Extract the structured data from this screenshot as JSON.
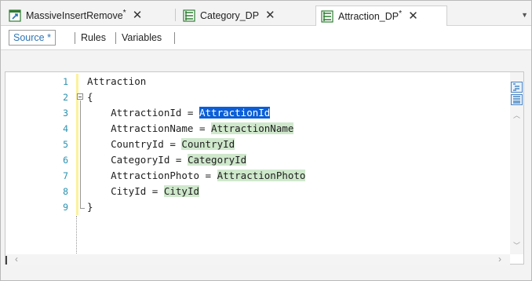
{
  "tabs": [
    {
      "label": "MassiveInsertRemove",
      "dirty": "*",
      "icon": "procedure-icon",
      "active": false
    },
    {
      "label": "Category_DP",
      "dirty": "",
      "icon": "data-provider-icon",
      "active": false
    },
    {
      "label": "Attraction_DP",
      "dirty": "*",
      "icon": "data-provider-icon",
      "active": true
    }
  ],
  "subtabs": [
    "Source *",
    "Rules",
    "Variables"
  ],
  "code_lines": [
    {
      "num": "1",
      "parts": [
        {
          "t": "Attraction",
          "s": ""
        }
      ]
    },
    {
      "num": "2",
      "parts": [
        {
          "t": "{",
          "s": ""
        }
      ]
    },
    {
      "num": "3",
      "parts": [
        {
          "t": "    AttractionId = ",
          "s": ""
        },
        {
          "t": "AttractionId",
          "s": "sel"
        }
      ]
    },
    {
      "num": "4",
      "parts": [
        {
          "t": "    AttractionName = ",
          "s": ""
        },
        {
          "t": "AttractionName",
          "s": "hl"
        }
      ]
    },
    {
      "num": "5",
      "parts": [
        {
          "t": "    CountryId = ",
          "s": ""
        },
        {
          "t": "CountryId",
          "s": "hl"
        }
      ]
    },
    {
      "num": "6",
      "parts": [
        {
          "t": "    CategoryId = ",
          "s": ""
        },
        {
          "t": "CategoryId",
          "s": "hl"
        }
      ]
    },
    {
      "num": "7",
      "parts": [
        {
          "t": "    AttractionPhoto = ",
          "s": ""
        },
        {
          "t": "AttractionPhoto",
          "s": "hl"
        }
      ]
    },
    {
      "num": "8",
      "parts": [
        {
          "t": "    CityId = ",
          "s": ""
        },
        {
          "t": "CityId",
          "s": "hl"
        }
      ]
    },
    {
      "num": "9",
      "parts": [
        {
          "t": "}",
          "s": ""
        }
      ]
    }
  ],
  "colors": {
    "line_number": "#2b91af",
    "highlight": "#cfe8cc",
    "selection": "#0b5ed7",
    "accent": "#2e75b6"
  },
  "icons": {
    "close": "close-icon",
    "overflow": "chevron-down-icon",
    "scroll_left": "chevron-left-icon",
    "scroll_right": "chevron-right-icon",
    "scroll_up": "chevron-up-icon",
    "scroll_down": "chevron-down-icon"
  }
}
